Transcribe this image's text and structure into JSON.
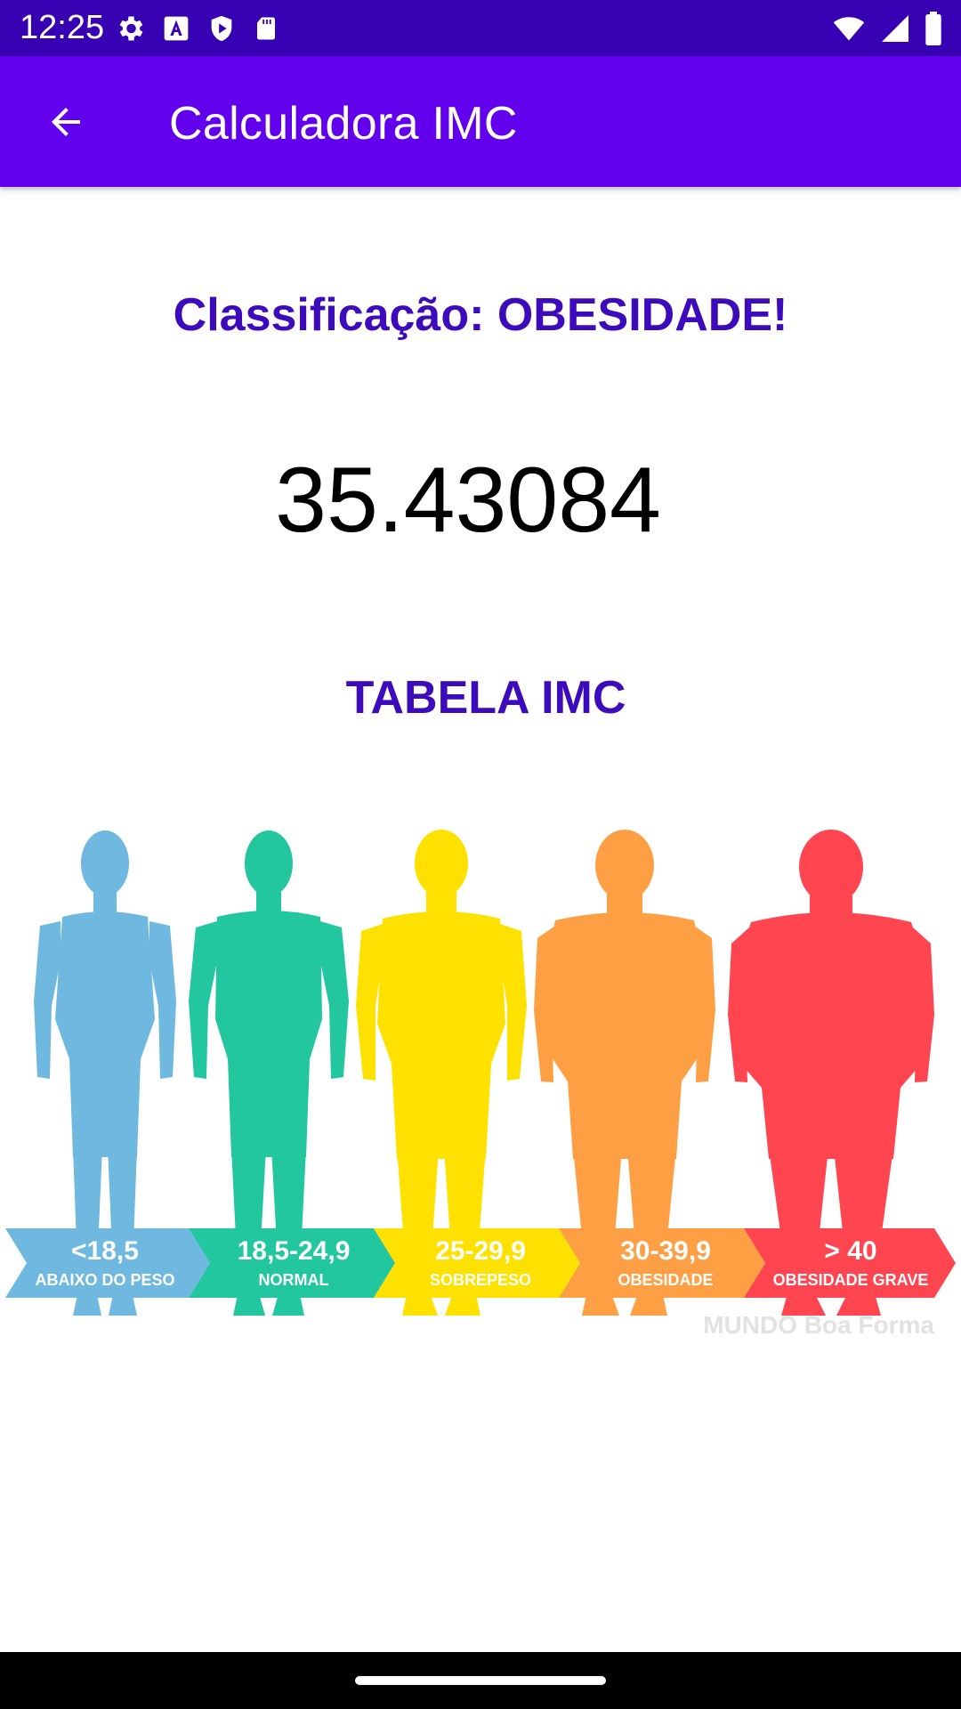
{
  "status_bar": {
    "time": "12:25",
    "icons_left": [
      "settings-icon",
      "text-a-icon",
      "play-protect-icon",
      "sd-card-icon"
    ],
    "icons_right": [
      "wifi-icon",
      "signal-icon",
      "battery-icon"
    ]
  },
  "app_bar": {
    "title": "Calculadora IMC",
    "back_icon": "arrow-back-icon",
    "color": "#6200ee",
    "status_color": "#3700b3"
  },
  "result": {
    "classification": "Classificação: OBESIDADE!",
    "bmi_value": "35.43084"
  },
  "table": {
    "title": "TABELA IMC",
    "categories": [
      {
        "range": "<18,5",
        "label": "ABAIXO DO PESO",
        "color": "#6fb8df"
      },
      {
        "range": "18,5-24,9",
        "label": "NORMAL",
        "color": "#22c7a0"
      },
      {
        "range": "25-29,9",
        "label": "SOBREPESO",
        "color": "#ffe100"
      },
      {
        "range": "30-39,9",
        "label": "OBESIDADE",
        "color": "#ff9f44"
      },
      {
        "range": "> 40",
        "label": "OBESIDADE GRAVE",
        "color": "#ff4550"
      }
    ],
    "watermark": "MUNDO Boa Forma"
  },
  "accent_text_color": "#3d0bbb"
}
